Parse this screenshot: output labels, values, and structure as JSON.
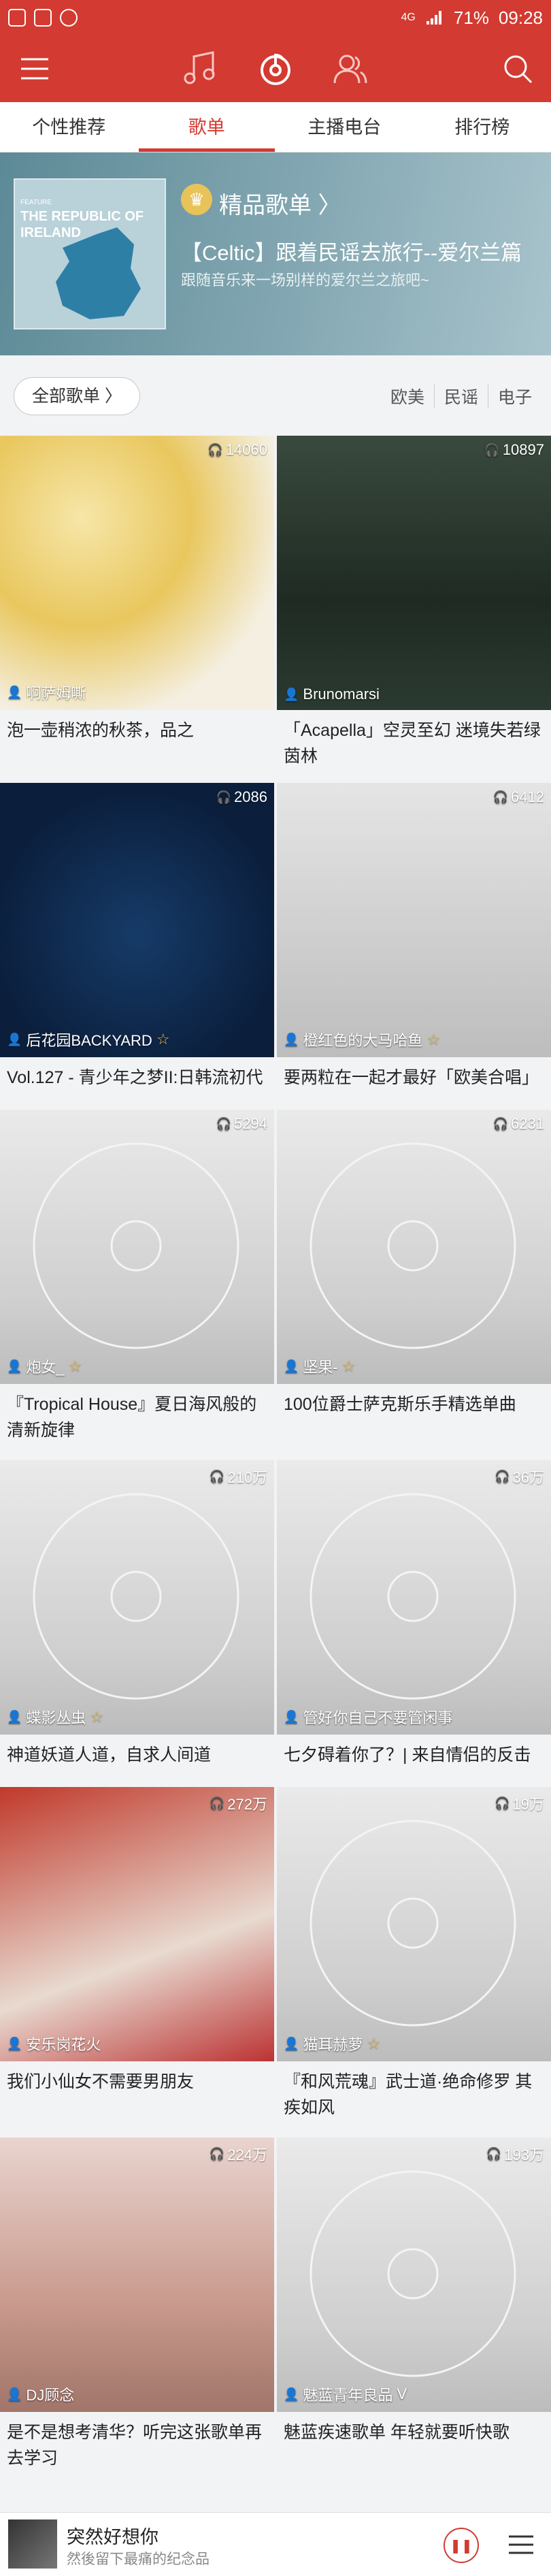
{
  "status": {
    "battery": "71%",
    "time": "09:28",
    "network": "4G"
  },
  "tabs": [
    {
      "label": "个性推荐",
      "active": false
    },
    {
      "label": "歌单",
      "active": true
    },
    {
      "label": "主播电台",
      "active": false
    },
    {
      "label": "排行榜",
      "active": false
    }
  ],
  "banner": {
    "cover_text_small": "FEATURE",
    "cover_text": "THE REPUBLIC OF IRELAND",
    "label": "精品歌单",
    "title": "【Celtic】跟着民谣去旅行--爱尔兰篇",
    "subtitle": "跟随音乐来一场别样的爱尔兰之旅吧~"
  },
  "filter": {
    "all_label": "全部歌单 〉",
    "tags": [
      "欧美",
      "民谣",
      "电子"
    ]
  },
  "playlists": [
    {
      "count": "14060",
      "creator": "啊萨姆嘶",
      "star": "",
      "desc": "泡一壶稍浓的秋茶，品之"
    },
    {
      "count": "10897",
      "creator": "Brunomarsi",
      "star": "",
      "desc": "「Acapella」空灵至幻 迷境失若绿茵林"
    },
    {
      "count": "2086",
      "creator": "后花园BACKYARD",
      "star": "☆",
      "desc": "Vol.127 - 青少年之梦II:日韩流初代"
    },
    {
      "count": "6412",
      "creator": "橙红色的大马哈鱼",
      "star": "☆",
      "desc": "要两粒在一起才最好「欧美合唱」"
    },
    {
      "count": "5294",
      "creator": "炮女_",
      "star": "☆",
      "desc": "『Tropical House』夏日海风般的清新旋律"
    },
    {
      "count": "6231",
      "creator": "坚果-",
      "star": "☆",
      "desc": "100位爵士萨克斯乐手精选单曲"
    },
    {
      "count": "210万",
      "creator": "蝶影丛虫",
      "star": "☆",
      "desc": "神道妖道人道，自求人间道"
    },
    {
      "count": "36万",
      "creator": "管好你自己不要管闲事",
      "star": "",
      "desc": "七夕碍着你了？| 来自情侣的反击"
    },
    {
      "count": "272万",
      "creator": "安乐岗花火",
      "star": "",
      "desc": "我们小仙女不需要男朋友"
    },
    {
      "count": "19万",
      "creator": "猫耳赫萝",
      "star": "☆",
      "desc": "『和风荒魂』武士道·绝命修罗 其疾如风"
    },
    {
      "count": "224万",
      "creator": "DJ顾念",
      "star": "",
      "desc": "是不是想考清华？听完这张歌单再去学习"
    },
    {
      "count": "193万",
      "creator": "魅蓝青年良品",
      "star": "V",
      "desc": "魅蓝疾速歌单 年轻就要听快歌"
    }
  ],
  "player": {
    "title": "突然好想你",
    "subtitle": "然後留下最痛的纪念品"
  },
  "colors": {
    "accent": "#d33a31"
  }
}
